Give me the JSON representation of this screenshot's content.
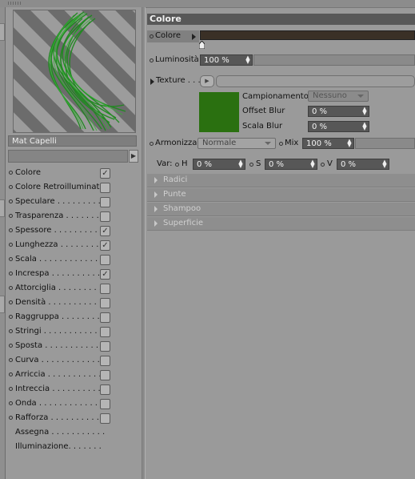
{
  "window": {
    "grip": "grip-icon"
  },
  "material": {
    "name": "Mat Capelli"
  },
  "channels": [
    {
      "label": "Colore",
      "checked": true,
      "dot": true
    },
    {
      "label": "Colore Retroilluminato",
      "checked": false,
      "dot": true
    },
    {
      "label": "Speculare . . . . . . . . .",
      "checked": false,
      "dot": true
    },
    {
      "label": "Trasparenza . . . . . . .",
      "checked": false,
      "dot": true
    },
    {
      "label": "Spessore . . . . . . . . .",
      "checked": true,
      "dot": true
    },
    {
      "label": "Lunghezza . . . . . . . .",
      "checked": true,
      "dot": true
    },
    {
      "label": "Scala . . . . . . . . . . . .",
      "checked": false,
      "dot": true
    },
    {
      "label": "Increspa . . . . . . . . . .",
      "checked": true,
      "dot": true
    },
    {
      "label": "Attorciglia . . . . . . . . .",
      "checked": false,
      "dot": true
    },
    {
      "label": "Densità . . . . . . . . . . .",
      "checked": false,
      "dot": true
    },
    {
      "label": "Raggruppa . . . . . . . .",
      "checked": false,
      "dot": true
    },
    {
      "label": "Stringi . . . . . . . . . . . .",
      "checked": false,
      "dot": true
    },
    {
      "label": "Sposta . . . . . . . . . . .",
      "checked": false,
      "dot": true
    },
    {
      "label": "Curva . . . . . . . . . . . .",
      "checked": false,
      "dot": true
    },
    {
      "label": "Arriccia . . . . . . . . . . .",
      "checked": false,
      "dot": true
    },
    {
      "label": "Intreccia . . . . . . . . . .",
      "checked": false,
      "dot": true
    },
    {
      "label": "Onda . . . . . . . . . . . .",
      "checked": false,
      "dot": true
    },
    {
      "label": "Rafforza . . . . . . . . . . .",
      "checked": false,
      "dot": true
    },
    {
      "label": "Assegna . . . . . . . . . . .",
      "checked": null,
      "dot": false
    },
    {
      "label": "Illuminazione. . . . . . . .",
      "checked": null,
      "dot": false
    }
  ],
  "panel": {
    "title": "Colore",
    "color_label": "Colore",
    "color_bar": "#3a3026",
    "luminosity_label": "Luminosità",
    "luminosity_value": "100 %",
    "texture_label": "Texture . . .",
    "sampling_label": "Campionamento",
    "sampling_value": "Nessuno",
    "offset_label": "Offset Blur",
    "offset_value": "0 %",
    "scale_label": "Scala Blur",
    "scale_value": "0 %",
    "swatch_color": "#2a7010",
    "harmonize_label": "Armonizza",
    "harmonize_value": "Normale",
    "mix_label": "Mix",
    "mix_value": "100 %",
    "var_label": "Var:",
    "h_label": "H",
    "h_value": "0 %",
    "s_label": "S",
    "s_value": "0 %",
    "v_label": "V",
    "v_value": "0 %"
  },
  "sections": [
    "Radici",
    "Punte",
    "Shampoo",
    "Superficie"
  ]
}
